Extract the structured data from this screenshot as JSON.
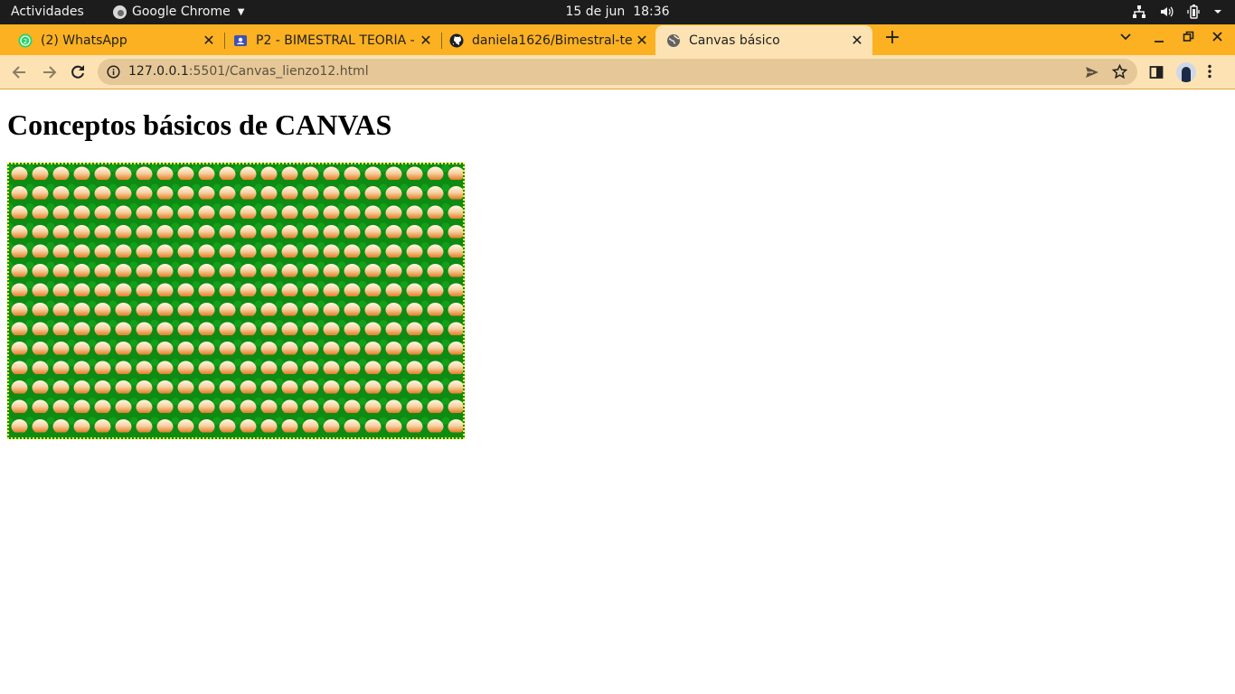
{
  "system_bar": {
    "activities": "Actividades",
    "app_name": "Google Chrome",
    "date": "15 de jun",
    "time": "18:36"
  },
  "tabs": [
    {
      "label": "(2) WhatsApp",
      "icon": "whatsapp-icon",
      "active": false
    },
    {
      "label": "P2 - BIMESTRAL TEORÍA - (",
      "icon": "classroom-icon",
      "active": false
    },
    {
      "label": "daniela1626/Bimestral-te",
      "icon": "github-icon",
      "active": false
    },
    {
      "label": "Canvas básico",
      "icon": "globe-icon",
      "active": true
    }
  ],
  "address_bar": {
    "host": "127.0.0.1",
    "path": ":5501/Canvas_lienzo12.html"
  },
  "page": {
    "heading": "Conceptos básicos de CANVAS"
  },
  "colors": {
    "tab_strip": "#fbb122",
    "toolbar": "#fde3b3",
    "canvas_background": "#0e8b12",
    "canvas_border": "#f4ef2a",
    "pattern_top": "#fff8e6",
    "pattern_bottom": "#e26a0e"
  }
}
